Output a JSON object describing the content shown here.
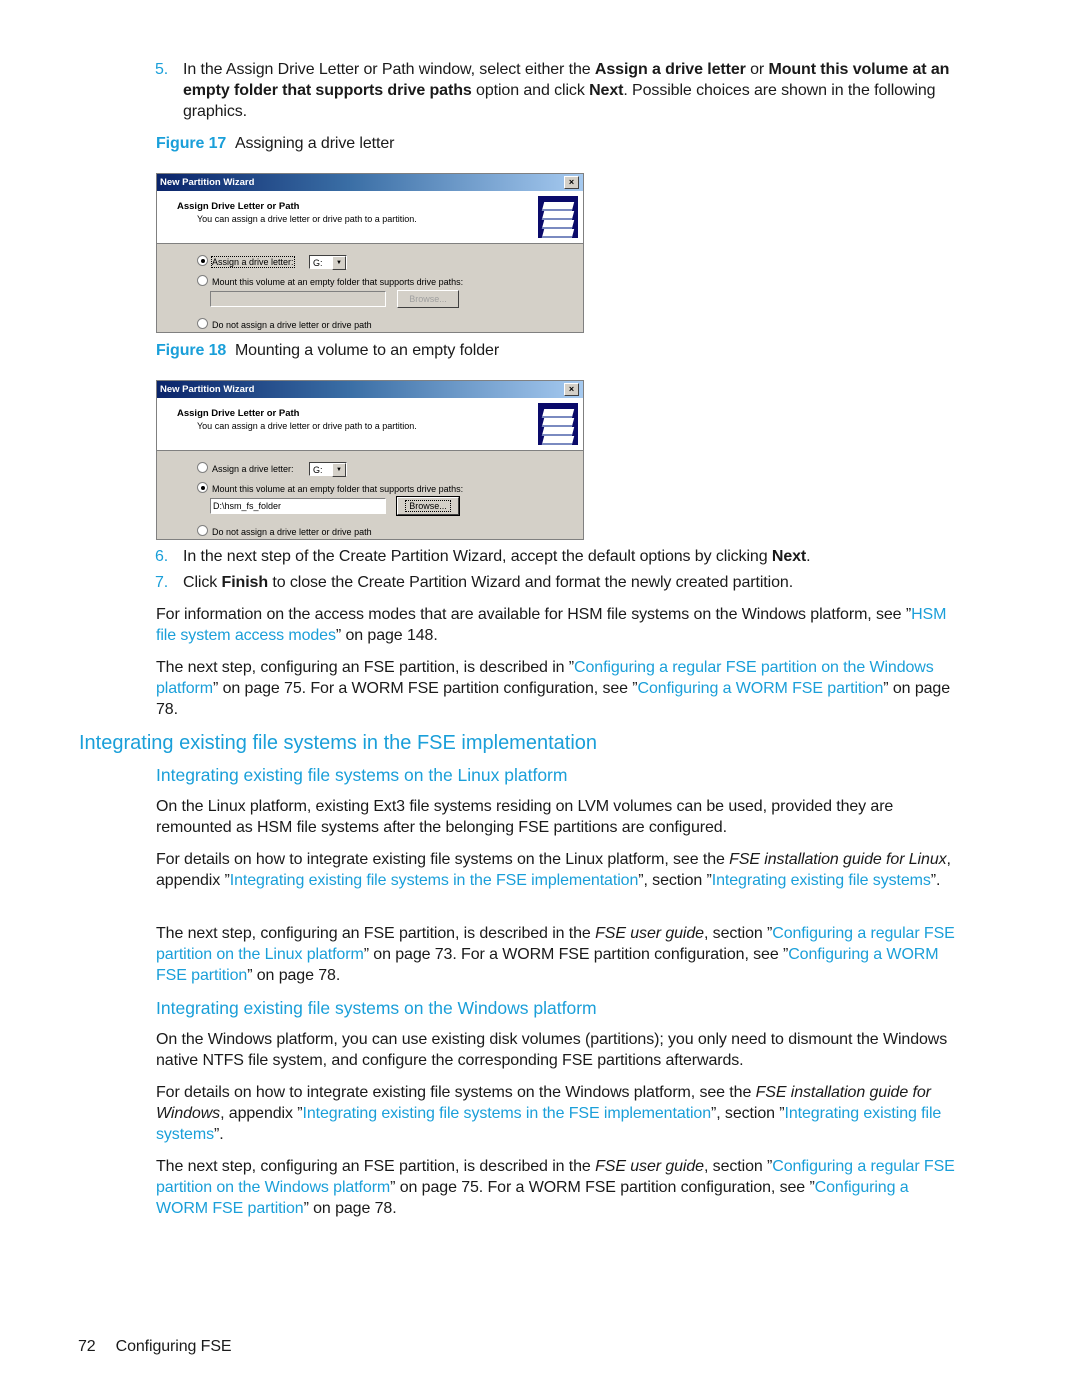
{
  "steps_top": {
    "step5": {
      "num": "5.",
      "t1": "In the Assign Drive Letter or Path window, select either the ",
      "b1": "Assign a drive letter",
      "t2": " or ",
      "b2": "Mount this volume at an empty folder that supports drive paths",
      "t3": " option and click ",
      "b3": "Next",
      "t4": ". Possible choices are shown in the following graphics."
    }
  },
  "figure17": {
    "label": "Figure 17",
    "caption": "Assigning a drive letter",
    "dialog": {
      "title": "New Partition Wizard",
      "close": "×",
      "heading": "Assign Drive Letter or Path",
      "subheading": "You can assign a drive letter or drive path to a partition.",
      "opt_assign": "Assign a drive letter:",
      "opt_assign_selected": true,
      "drive_value": "G:",
      "opt_mount": "Mount this volume at an empty folder that supports drive paths:",
      "opt_mount_selected": false,
      "path_value": "",
      "browse": "Browse...",
      "opt_none": "Do not assign a drive letter or drive path"
    }
  },
  "figure18": {
    "label": "Figure 18",
    "caption": "Mounting a volume to an empty folder",
    "dialog": {
      "title": "New Partition Wizard",
      "close": "×",
      "heading": "Assign Drive Letter or Path",
      "subheading": "You can assign a drive letter or drive path to a partition.",
      "opt_assign": "Assign a drive letter:",
      "opt_assign_selected": false,
      "drive_value": "G:",
      "opt_mount": "Mount this volume at an empty folder that supports drive paths:",
      "opt_mount_selected": true,
      "path_value": "D:\\hsm_fs_folder",
      "browse": "Browse...",
      "opt_none": "Do not assign a drive letter or drive path"
    }
  },
  "step6": {
    "num": "6.",
    "t1": "In the next step of the Create Partition Wizard, accept the default options by clicking ",
    "b1": "Next",
    "t2": "."
  },
  "step7": {
    "num": "7.",
    "t1": "Click ",
    "b1": "Finish",
    "t2": " to close the Create Partition Wizard and format the newly created partition."
  },
  "para_access": {
    "t1": "For information on the access modes that are available for HSM file systems on the Windows platform, see ”",
    "link1": "HSM file system access modes",
    "t2": "” on page 148."
  },
  "para_next1": {
    "t1": "The next step, configuring an FSE partition, is described in ”",
    "link1": "Configuring a regular FSE partition on the Windows platform",
    "t2": "” on page 75. For a WORM FSE partition configuration, see ”",
    "link2": "Configuring a WORM FSE partition",
    "t3": "” on page 78."
  },
  "section_heading": "Integrating existing file systems in the FSE implementation",
  "linux": {
    "heading": "Integrating existing file systems on the Linux platform",
    "p1": "On the Linux platform, existing Ext3 file systems residing on LVM volumes can be used, provided they are remounted as HSM file systems after the belonging FSE partitions are configured.",
    "p2": {
      "t1": "For details on how to integrate existing file systems on the Linux platform, see the ",
      "i1": "FSE installation guide for Linux",
      "t2": ", appendix ”",
      "link1": "Integrating existing file systems in the FSE implementation",
      "t3": "”, section ”",
      "link2": "Integrating existing file systems",
      "t4": "”."
    },
    "p3": {
      "t1": "The next step, configuring an FSE partition, is described in the ",
      "i1": "FSE user guide",
      "t2": ", section ”",
      "link1": "Configuring a regular FSE partition on the Linux platform",
      "t3": "” on page 73. For a WORM FSE partition configuration, see ”",
      "link2": "Configuring a WORM FSE partition",
      "t4": "” on page 78."
    }
  },
  "windows": {
    "heading": "Integrating existing file systems on the Windows platform",
    "p1": "On the Windows platform, you can use existing disk volumes (partitions); you only need to dismount the Windows native NTFS file system, and configure the corresponding FSE partitions afterwards.",
    "p2": {
      "t1": "For details on how to integrate existing file systems on the Windows platform, see the ",
      "i1": "FSE installation guide for Windows",
      "t2": ", appendix ”",
      "link1": "Integrating existing file systems in the FSE implementation",
      "t3": "”, section ”",
      "link2": "Integrating existing file systems",
      "t4": "”."
    },
    "p3": {
      "t1": "The next step, configuring an FSE partition, is described in the ",
      "i1": "FSE user guide",
      "t2": ", section ”",
      "link1": "Configuring a regular FSE partition on the Windows platform",
      "t3": "” on page 75. For a WORM FSE partition configuration, see ”",
      "link2": "Configuring a WORM FSE partition",
      "t4": "” on page 78."
    }
  },
  "footer": {
    "page_number": "72",
    "chapter": "Configuring FSE"
  },
  "colors": {
    "accent": "#1a9fd9",
    "text": "#1a1a1a",
    "dialog_bg": "#d4d0c8",
    "titlebar": "#0a246a"
  }
}
